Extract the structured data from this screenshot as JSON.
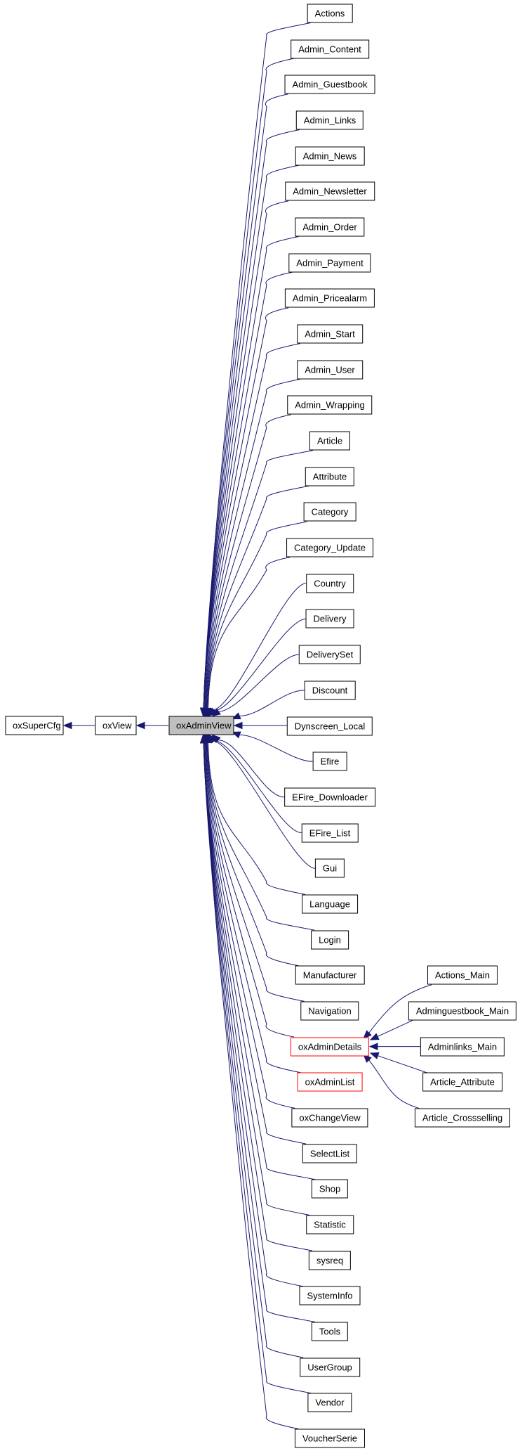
{
  "diagram": {
    "type": "class-inheritance-graph",
    "edge_color": "#191970",
    "current_fill": "#bfbfbf",
    "truncated_border": "#ff0000",
    "ancestors": [
      {
        "id": "oxSuperCfg",
        "label": "oxSuperCfg"
      },
      {
        "id": "oxView",
        "label": "oxView"
      }
    ],
    "current": {
      "id": "oxAdminView",
      "label": "oxAdminView"
    },
    "children": [
      {
        "label": "Actions"
      },
      {
        "label": "Admin_Content"
      },
      {
        "label": "Admin_Guestbook"
      },
      {
        "label": "Admin_Links"
      },
      {
        "label": "Admin_News"
      },
      {
        "label": "Admin_Newsletter"
      },
      {
        "label": "Admin_Order"
      },
      {
        "label": "Admin_Payment"
      },
      {
        "label": "Admin_Pricealarm"
      },
      {
        "label": "Admin_Start"
      },
      {
        "label": "Admin_User"
      },
      {
        "label": "Admin_Wrapping"
      },
      {
        "label": "Article"
      },
      {
        "label": "Attribute"
      },
      {
        "label": "Category"
      },
      {
        "label": "Category_Update"
      },
      {
        "label": "Country"
      },
      {
        "label": "Delivery"
      },
      {
        "label": "DeliverySet"
      },
      {
        "label": "Discount"
      },
      {
        "label": "Dynscreen_Local"
      },
      {
        "label": "Efire"
      },
      {
        "label": "EFire_Downloader"
      },
      {
        "label": "EFire_List"
      },
      {
        "label": "Gui"
      },
      {
        "label": "Language"
      },
      {
        "label": "Login"
      },
      {
        "label": "Manufacturer"
      },
      {
        "label": "Navigation"
      },
      {
        "label": "oxAdminDetails",
        "truncated": true
      },
      {
        "label": "oxAdminList",
        "truncated": true
      },
      {
        "label": "oxChangeView"
      },
      {
        "label": "SelectList"
      },
      {
        "label": "Shop"
      },
      {
        "label": "Statistic"
      },
      {
        "label": "sysreq"
      },
      {
        "label": "SystemInfo"
      },
      {
        "label": "Tools"
      },
      {
        "label": "UserGroup"
      },
      {
        "label": "Vendor"
      },
      {
        "label": "VoucherSerie"
      }
    ],
    "grandchildren": {
      "parent": "oxAdminDetails",
      "items": [
        {
          "label": "Actions_Main"
        },
        {
          "label": "Adminguestbook_Main"
        },
        {
          "label": "Adminlinks_Main"
        },
        {
          "label": "Article_Attribute"
        },
        {
          "label": "Article_Crossselling"
        }
      ]
    }
  }
}
